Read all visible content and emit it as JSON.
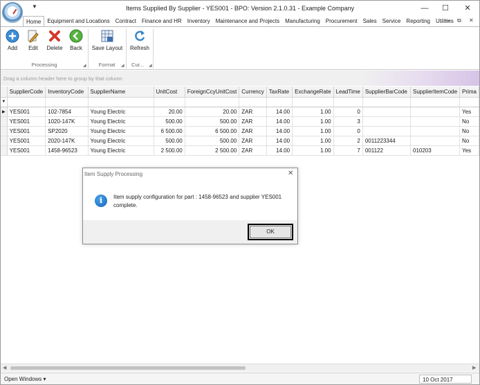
{
  "window": {
    "title": "Items Supplied By Supplier - YES001 - BPO: Version 2.1.0.31 - Example Company",
    "minimize_glyph": "—",
    "maximize_glyph": "☐",
    "close_glyph": "✕",
    "quick_access_glyph": "▼"
  },
  "ribbon": {
    "tabs": [
      "Home",
      "Equipment and Locations",
      "Contract",
      "Finance and HR",
      "Inventory",
      "Maintenance and Projects",
      "Manufacturing",
      "Procurement",
      "Sales",
      "Service",
      "Reporting",
      "Utilities"
    ],
    "right_controls": {
      "minimize": "—",
      "restore": "⧉",
      "close": "✕"
    },
    "buttons": {
      "add": "Add",
      "edit": "Edit",
      "delete": "Delete",
      "back": "Back",
      "save_layout": "Save Layout",
      "refresh": "Refresh"
    },
    "groups": {
      "processing": "Processing",
      "format": "Format",
      "current": "Cur..."
    },
    "icons": {
      "add": "add-icon",
      "edit": "edit-icon",
      "delete": "delete-icon",
      "back": "back-icon",
      "save_layout": "save-layout-icon",
      "refresh": "refresh-icon"
    }
  },
  "groupby": {
    "hint": "Drag a column header here to group by that column"
  },
  "grid": {
    "columns": [
      "SupplierCode",
      "InventoryCode",
      "SupplierName",
      "UnitCost",
      "ForeignCcyUnitCost",
      "Currency",
      "TaxRate",
      "ExchangeRate",
      "LeadTime",
      "SupplierBarCode",
      "SupplierItemCode",
      "Prima"
    ],
    "rows": [
      [
        "YES001",
        "102-7854",
        "Young Electric",
        "20.00",
        "20.00",
        "ZAR",
        "14.00",
        "1.00",
        "0",
        "",
        "",
        "Yes"
      ],
      [
        "YES001",
        "1020-147K",
        "Young Electric",
        "500.00",
        "500.00",
        "ZAR",
        "14.00",
        "1.00",
        "3",
        "",
        "",
        "No"
      ],
      [
        "YES001",
        "SP2020",
        "Young Electric",
        "6 500.00",
        "6 500.00",
        "ZAR",
        "14.00",
        "1.00",
        "0",
        "",
        "",
        "No"
      ],
      [
        "YES001",
        "2020-147K",
        "Young Electric",
        "500.00",
        "500.00",
        "ZAR",
        "14.00",
        "1.00",
        "2",
        "0011223344",
        "",
        "No"
      ],
      [
        "YES001",
        "1458-96523",
        "Young Electric",
        "2 500.00",
        "2 500.00",
        "ZAR",
        "14.00",
        "1.00",
        "7",
        "001122",
        "010203",
        "Yes"
      ]
    ],
    "current_row_glyph": "▶",
    "filter_glyph": "▼"
  },
  "dialog": {
    "title": "Item Supply Processing",
    "close_glyph": "✕",
    "icon": "info-icon",
    "icon_glyph": "i",
    "message": "Item supply configuration for part : 1458-96523 and supplier YES001 complete.",
    "ok_label": "OK"
  },
  "statusbar": {
    "open_windows": "Open Windows ▾",
    "date": "10 Oct 2017"
  },
  "scrollbar": {
    "left_arrow": "◀",
    "right_arrow": "▶"
  }
}
